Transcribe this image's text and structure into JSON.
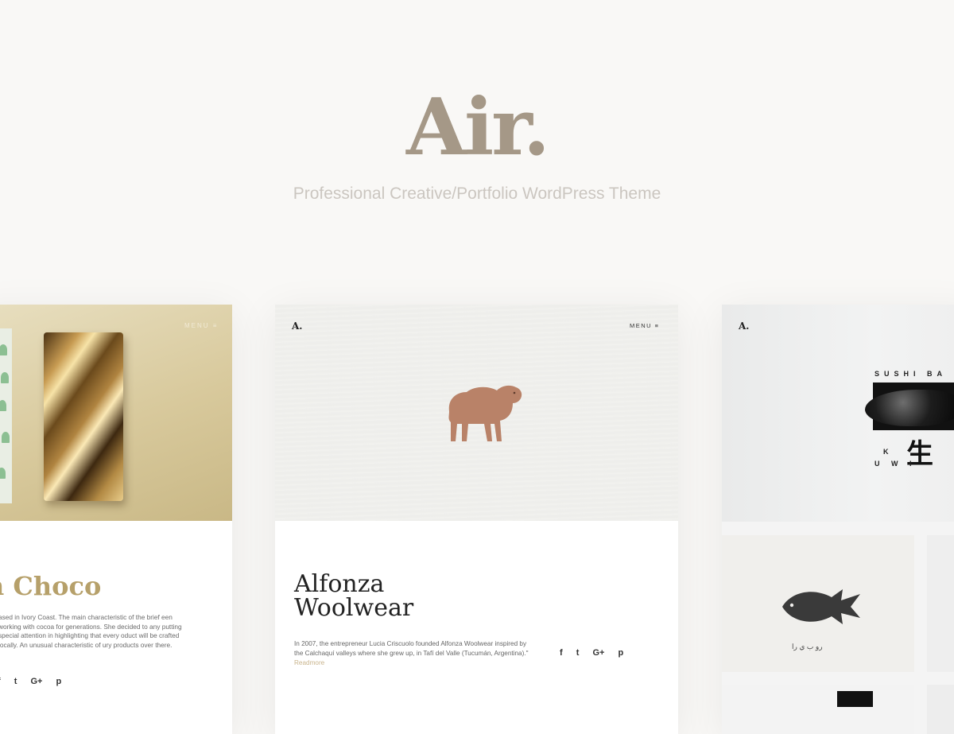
{
  "hero": {
    "title": "Air.",
    "subtitle": "Professional Creative/Portfolio WordPress Theme"
  },
  "left_card": {
    "menu": "MENU ≡",
    "title": "n Choco",
    "text": "ased in Ivory Coast. The main characteristic of the brief een working with cocoa for generations. She decided to any putting special attention in highlighting that every oduct will be crafted locally. An unusual characteristic of ury products over there.",
    "social": [
      "f",
      "t",
      "G+",
      "p"
    ]
  },
  "center_card": {
    "logo": "A.",
    "menu": "MENU ≡",
    "title_line1": "Alfonza",
    "title_line2": "Woolwear",
    "text": "In 2007, the entrepreneur Lucia Criscuolo founded Alfonza Woolwear inspired by the Calchaquí valleys where she grew up, in Tafí del Valle (Tucumán, Argentina).\"",
    "readmore": "Readmore",
    "social": [
      "f",
      "t",
      "G+",
      "p"
    ]
  },
  "right_card": {
    "logo": "A.",
    "sushi_label": "SUSHI BA",
    "line_k": "K",
    "line_uwi": "U W I",
    "kanji": "生",
    "arabic": "رو ب ي را"
  },
  "colors": {
    "background": "#f9f8f6",
    "title": "#a59887",
    "subtitle": "#cbc6c0",
    "accent_gold": "#b6a06a",
    "readmore": "#c9b48c"
  }
}
